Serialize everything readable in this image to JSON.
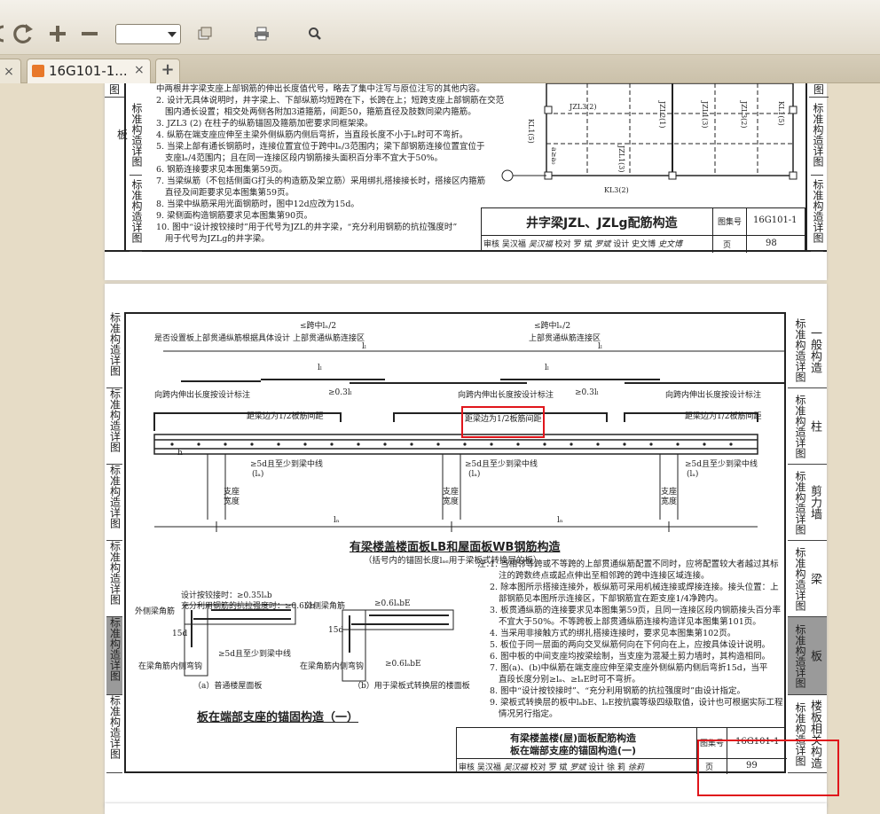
{
  "toolbar": {
    "zoom_value": ""
  },
  "tabs": [
    {
      "label": "×"
    },
    {
      "label": "16G101-1...",
      "close": "×"
    },
    {
      "label": "+"
    }
  ],
  "page1": {
    "left_strip": [
      "图",
      "标准构造详图",
      "标准构造详图"
    ],
    "left_strip_extra": "板",
    "right_strip": [
      "图",
      "标准构造详图",
      "标准构造详图"
    ],
    "notes": [
      "中两根井字梁支座上部钢筋的伸出长度值代号，略去了集中注写与原位注写的其他内容。",
      "2. 设计无具体说明时，井字梁上、下部纵筋均短跨在下，长跨在上；短跨支座上部钢筋在交范",
      "围内通长设置；相交处两侧各附加3道箍筋，间距50，箍筋直径及肢数同梁内箍筋。",
      "3. JZL3 (2) 在柱子的纵筋锚固及箍筋加密要求同框架梁。",
      "4. 纵筋在端支座应伸至主梁外侧纵筋内侧后弯折，当直段长度不小于lₐ时可不弯折。",
      "5. 当梁上部有通长钢筋时，连接位置宜位于跨中lₙ/3范围内；梁下部钢筋连接位置宜位于",
      "支座lₙ/4范围内；且在同一连接区段内钢筋接头面积百分率不宜大于50%。",
      "6. 钢筋连接要求见本图集第59页。",
      "7. 当梁纵筋（不包括侧面G打头的构造筋及架立筋）采用绑扎搭接接长时，搭接区内箍筋",
      "直径及间距要求见本图集第59页。",
      "8. 当梁中纵筋采用光面钢筋时，图中12d应改为15d。",
      "9. 梁侧面构造钢筋要求见本图集第90页。",
      "10. 图中“设计按铰接时”用于代号为JZL的井字梁，“充分利用钢筋的抗拉强度时”",
      "用于代号为JZLg的井字梁。"
    ],
    "plan_labels": [
      "JZL3(2)",
      "JZL1(3)",
      "JZL2(1)",
      "JZL3(2)",
      "KL1(5)",
      "KL1(5)",
      "KL3(2)",
      "a≥a₀",
      "JZL1(3)"
    ],
    "title": "井字梁JZL、JZLg配筋构造",
    "atlas_label": "图集号",
    "atlas_no": "16G101-1",
    "page_label": "页",
    "page_no": "98",
    "sign_row": [
      "审核",
      "吴汉福",
      "吴汉福",
      "校对",
      "罗 斌",
      "罗斌",
      "设计",
      "史文博",
      "史文博"
    ]
  },
  "page2": {
    "left_strip": [
      "标准构造详图",
      "标准构造详图",
      "标准构造详图",
      "标准构造详图",
      "标准构造详图",
      "标准构造详图"
    ],
    "right_strip": [
      {
        "a": "标准构造详图",
        "b": "一般构造"
      },
      {
        "a": "标准构造详图",
        "b": "柱"
      },
      {
        "a": "标准构造详图",
        "b": "剪力墙"
      },
      {
        "a": "标准构造详图",
        "b": "梁"
      },
      {
        "a": "标准构造详图",
        "b": "板"
      },
      {
        "a": "标准构造详图",
        "b": "楼板相关构造"
      }
    ],
    "diagram_texts": {
      "top_left_1": "≤跨中lₙ/2",
      "top_left_2": "上部贯通纵筋连接区",
      "top_right_1": "≤跨中lₙ/2",
      "top_right_2": "上部贯通纵筋连接区",
      "design_note": "是否设置板上部贯通纵筋根据具体设计",
      "l_l1": "lₗ",
      "l_l2": "lₗ",
      "l_l3": "lₗ",
      "l_l4": "lₗ",
      "ext_1": "向跨内伸出长度按设计标注",
      "ext_2": "向跨内伸出长度按设计标注",
      "ext_3": "向跨内伸出长度按设计标注",
      "lap_1": "≥0.3lₗ",
      "lap_2": "≥0.3lₗ",
      "dist_1": "距梁边为1/2板筋间距",
      "dist_2": "距梁边为1/2板筋间距",
      "dist_3": "距梁边为1/2板筋间距",
      "anch_1": "≥5d且至少到梁中线",
      "anch_2": "≥5d且至少到梁中线",
      "anch_3": "≥5d且至少到梁中线",
      "la_1": "(lₐ)",
      "la_2": "(lₐ)",
      "la_3": "(lₐ)",
      "sup_1": "支座宽度",
      "sup_2": "支座宽度",
      "sup_3": "支座宽度",
      "span_1": "lₙ",
      "span_2": "lₙ",
      "h_label": "h"
    },
    "main_title": "有梁楼盖楼面板LB和屋面板WB钢筋构造",
    "main_subtitle": "（括号内的锚固长度lₐₑ用于梁板式转换层的板）",
    "detail_a_texts": {
      "t1": "设计按铰接时：≥0.35lₐb",
      "t2": "充分利用钢筋的抗拉强度时：≥0.6lₐb",
      "t3": "外侧梁角筋",
      "t4": "15d",
      "t5": "≥5d且至少到梁中线",
      "t6": "在梁角筋内侧弯钩",
      "caption": "（a）普通楼屋面板"
    },
    "detail_b_texts": {
      "t1": "外侧梁角筋",
      "t2": "≥0.6lₐbE",
      "t3": "15d",
      "t4": "在梁角筋内侧弯钩",
      "t5": "≥0.6lₐbE",
      "caption": "（b）用于梁板式转换层的楼面板"
    },
    "section_title": "板在端部支座的锚固构造（一）",
    "notes_title": "注：",
    "notes": [
      "1. 当相邻等跨或不等跨的上部贯通纵筋配置不同时，应将配置较大者越过其标",
      "注的跨数终点或起点伸出至相邻跨的跨中连接区域连接。",
      "2. 除本图所示搭接连接外，板纵筋可采用机械连接或焊接连接。接头位置：上",
      "部钢筋见本图所示连接区，下部钢筋宜在距支座1/4净跨内。",
      "3. 板贯通纵筋的连接要求见本图集第59页，且同一连接区段内钢筋接头百分率",
      "不宜大于50%。不等跨板上部贯通纵筋连接构造详见本图集第101页。",
      "4. 当采用非接触方式的绑扎搭接连接时，要求见本图集第102页。",
      "5. 板位于同一层面的两向交叉纵筋何向在下何向在上，应按具体设计说明。",
      "6. 图中板的中间支座均按梁绘制，当支座为混凝土剪力墙时，其构造相同。",
      "7. 图(a)、(b)中纵筋在端支座应伸至梁支座外侧纵筋内侧后弯折15d，当平",
      "直段长度分别≥lₐ、≥lₐE时可不弯折。",
      "8. 图中“设计按铰接时”、“充分利用钢筋的抗拉强度时”由设计指定。",
      "9. 梁板式转换层的板中lₐbE、lₐE按抗震等级四级取值，设计也可根据实际工程",
      "情况另行指定。"
    ],
    "title_line1": "有梁楼盖楼(屋)面板配筋构造",
    "title_line2": "板在端部支座的锚固构造(一)",
    "atlas_label": "图集号",
    "atlas_no": "16G101-1",
    "page_label": "页",
    "page_no": "99",
    "sign_row": [
      "审核",
      "吴汉福",
      "吴汉福",
      "校对",
      "罗 斌",
      "罗斌",
      "设计",
      "徐 莉",
      "徐莉"
    ]
  },
  "colors": {
    "highlight_red": "#e0151b",
    "toolbar_bg": "#ece6d8",
    "viewer_bg": "#e6dcc6",
    "tab_icon": "#e8782a"
  }
}
